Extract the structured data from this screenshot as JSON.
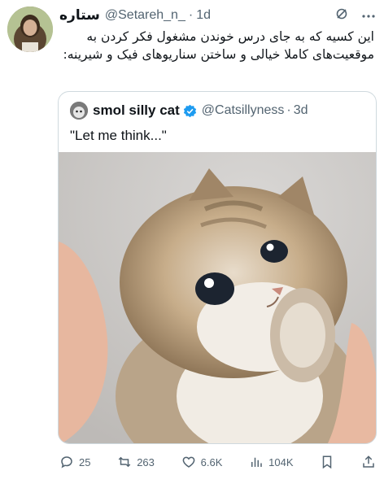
{
  "tweet": {
    "display_name": "ستاره",
    "handle": "@Setareh_n_",
    "time": "1d",
    "text": "این کسیه که به جای درس خوندن مشغول فکر کردن به موقعیت‌های کاملا خیالی و ساختن سناریوهای فیک و شیرینه:"
  },
  "quote": {
    "display_name": "smol silly cat",
    "handle": "@Catsillyness",
    "time": "3d",
    "text": "\"Let me think...\""
  },
  "actions": {
    "replies": "25",
    "reposts": "263",
    "likes": "6.6K",
    "views": "104K"
  },
  "icons": {
    "grok": "grok-icon",
    "more": "more-icon",
    "verified": "verified-icon",
    "reply": "reply-icon",
    "repost": "repost-icon",
    "like": "like-icon",
    "views": "views-icon",
    "bookmark": "bookmark-icon",
    "share": "share-icon"
  },
  "colors": {
    "verified": "#1d9bf0",
    "muted": "#536471",
    "border": "#cfd9de"
  }
}
